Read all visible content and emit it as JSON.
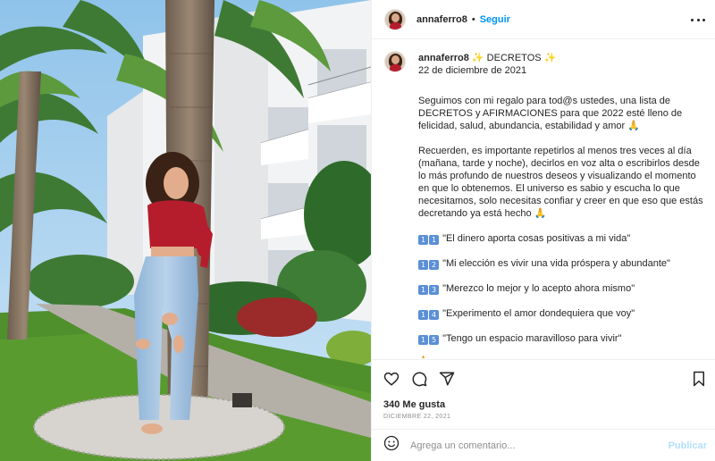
{
  "post": {
    "username": "annaferro8",
    "separator": "•",
    "follow_label": "Seguir",
    "caption": {
      "title_text": "✨ DECRETOS ✨",
      "date": "22 de diciembre de 2021",
      "paragraph1": "Seguimos con mi regalo para tod@s ustedes, una lista de DECRETOS y AFIRMACIONES para que 2022 esté lleno de felicidad, salud, abundancia, estabilidad y amor 🙏",
      "paragraph2": "Recuerden, es importante repetirlos al menos tres veces al día (mañana, tarde y noche), decirlos en voz alta o escribirlos desde lo más profundo de nuestros deseos y visualizando el momento en que lo obtenemos. El universo es sabio y escucha lo que necesitamos, solo necesitas confiar y creer en que eso que estás decretando ya está hecho 🙏",
      "decrees": [
        {
          "n1": "1",
          "n2": "1",
          "text": "\"El dinero aporta cosas positivas a mi vida\""
        },
        {
          "n1": "1",
          "n2": "2",
          "text": "\"Mi elección es vivir una vida próspera y abundante\""
        },
        {
          "n1": "1",
          "n2": "3",
          "text": "\"Merezco lo mejor y lo acepto ahora mismo\""
        },
        {
          "n1": "1",
          "n2": "4",
          "text": "\"Experimento el amor dondequiera que voy\""
        },
        {
          "n1": "1",
          "n2": "5",
          "text": "\"Tengo un espacio maravilloso para vivir\""
        }
      ],
      "trailing": "🙏 ↓↓"
    },
    "likes": "340 Me gusta",
    "date_caps": "DICIEMBRE 22, 2021",
    "comment_placeholder": "Agrega un comentario...",
    "publish_label": "Publicar"
  },
  "icons": {
    "more": "more-options-icon",
    "like": "heart-icon",
    "comment": "comment-icon",
    "share": "send-icon",
    "save": "bookmark-icon",
    "emoji": "emoji-icon"
  },
  "colors": {
    "accent": "#0095f6",
    "publish_disabled": "#b2dffc",
    "muted": "#8e8e8e",
    "text": "#262626",
    "keycap": "#5b8fd6"
  }
}
